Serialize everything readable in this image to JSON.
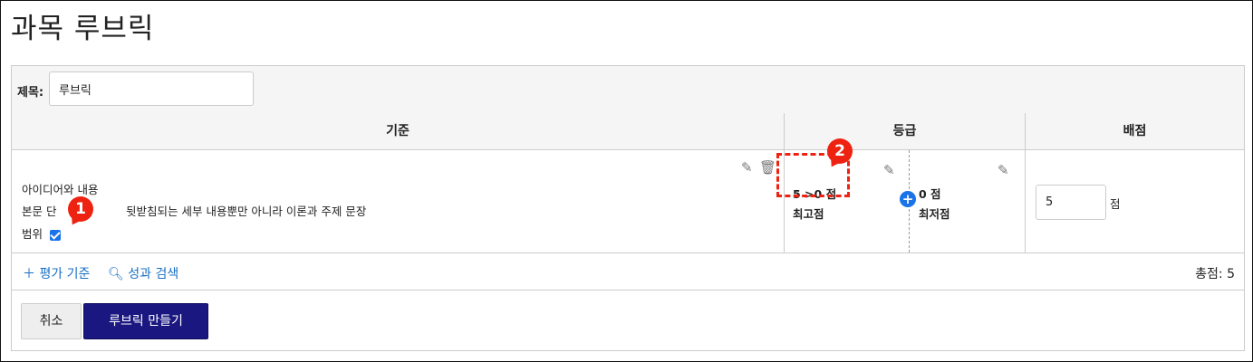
{
  "page_title": "과목 루브릭",
  "title_field": {
    "label": "제목:",
    "value": "루브릭"
  },
  "table": {
    "headers": {
      "criteria": "기준",
      "ratings": "등급",
      "points": "배점"
    },
    "criterion": {
      "name": "아이디어와 내용",
      "description_prefix": "본문 단",
      "description_suffix": "뒷받침되는 세부 내용뿐만 아니라 이론과 주제 문장",
      "range_label": "범위",
      "range_checked": true
    },
    "ratings": [
      {
        "points_label": "5 >0 점",
        "description": "최고점"
      },
      {
        "points_label": "0 점",
        "description": "최저점"
      }
    ],
    "points_value": "5",
    "points_unit": "점"
  },
  "actions": {
    "add_criterion": "평가 기준",
    "search_outcome": "성과 검색"
  },
  "total": "총점: 5",
  "buttons": {
    "cancel": "취소",
    "create": "루브릭 만들기"
  },
  "callouts": [
    "1",
    "2"
  ],
  "colors": {
    "accent": "#1a73e8",
    "callout": "#e21",
    "primary_button": "#1a1880"
  }
}
